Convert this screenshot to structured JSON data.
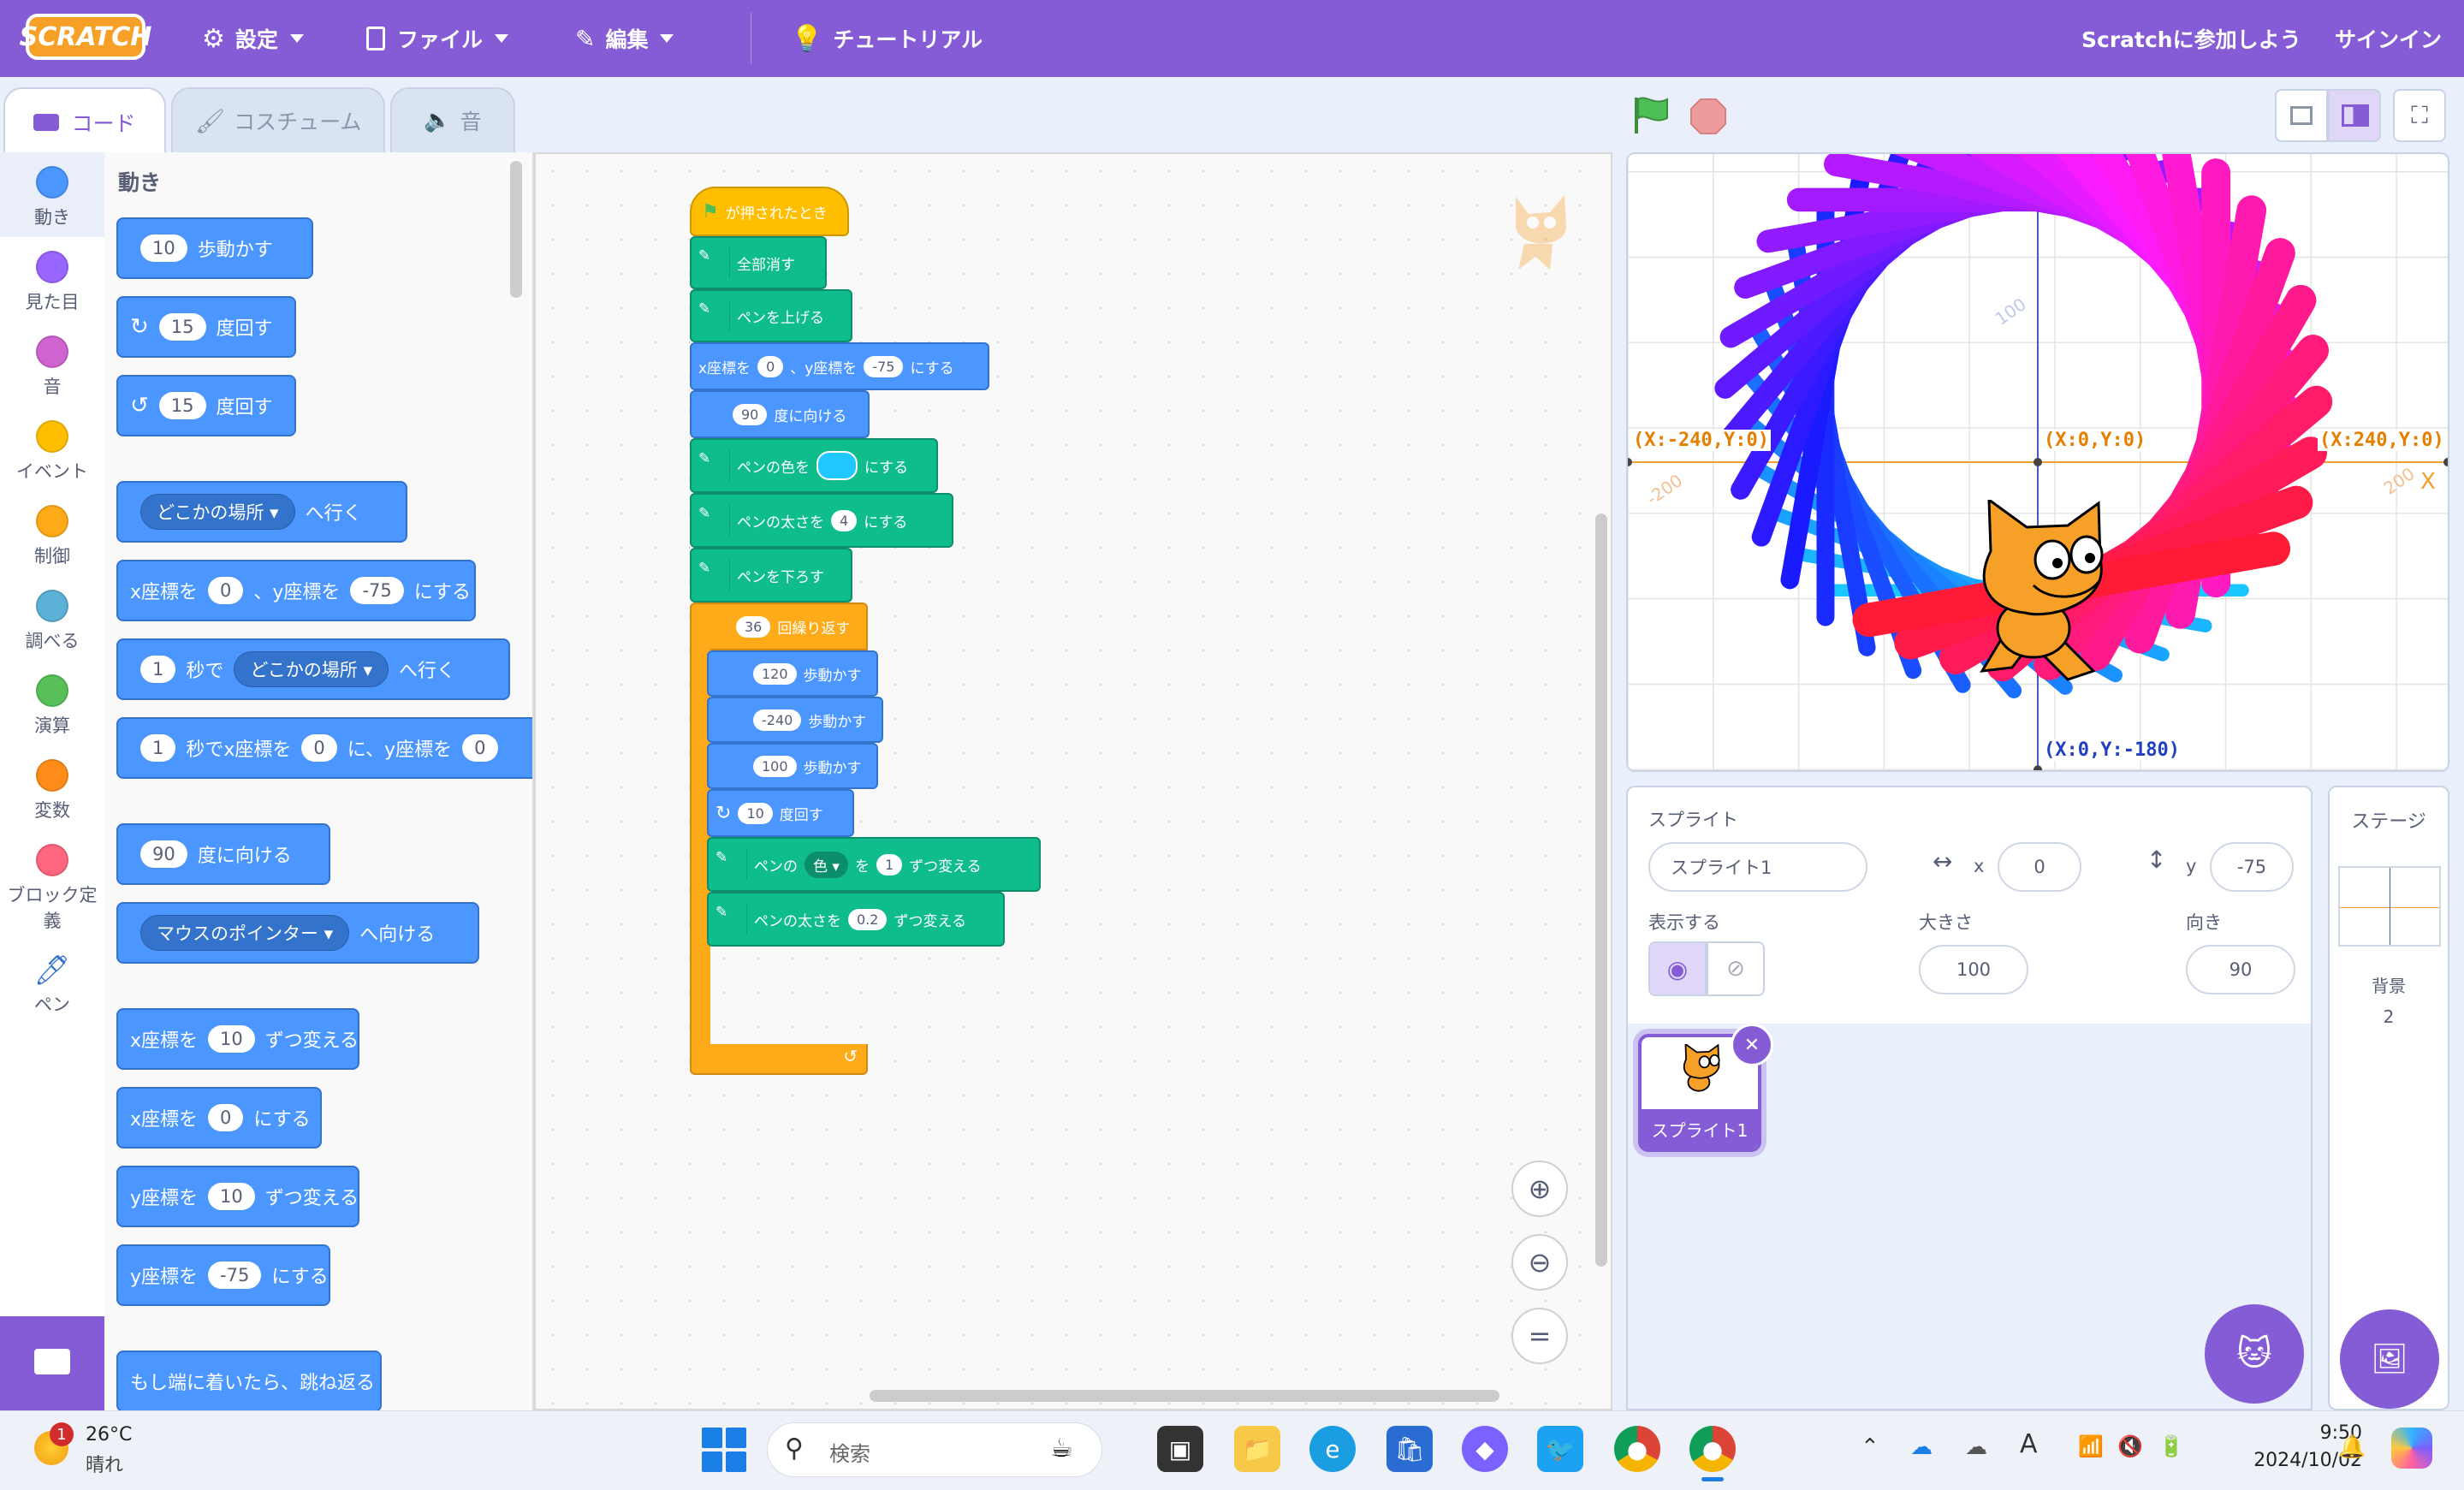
{
  "menu": {
    "logo": "SCRATCH",
    "settings": "設定",
    "file": "ファイル",
    "edit": "編集",
    "tutorials": "チュートリアル",
    "join": "Scratchに参加しよう",
    "signin": "サインイン"
  },
  "tabs": {
    "code": "コード",
    "costumes": "コスチューム",
    "sounds": "音"
  },
  "categories": [
    {
      "label": "動き",
      "color": "#4c97ff"
    },
    {
      "label": "見た目",
      "color": "#9966ff"
    },
    {
      "label": "音",
      "color": "#cf63cf"
    },
    {
      "label": "イベント",
      "color": "#ffbf00"
    },
    {
      "label": "制御",
      "color": "#ffab19"
    },
    {
      "label": "調べる",
      "color": "#5cb1d6"
    },
    {
      "label": "演算",
      "color": "#59c059"
    },
    {
      "label": "変数",
      "color": "#ff8c1a"
    },
    {
      "label": "ブロック定義",
      "color": "#ff6680"
    },
    {
      "label": "ペン",
      "color": "#0fbd8c"
    }
  ],
  "palette": {
    "heading": "動き",
    "move": {
      "value": "10",
      "suffix": "歩動かす"
    },
    "turn_right": {
      "value": "15",
      "suffix": "度回す"
    },
    "turn_left": {
      "value": "15",
      "suffix": "度回す"
    },
    "goto": {
      "drop": "どこかの場所",
      "suffix": "へ行く"
    },
    "setxy": {
      "p1": "x座標を",
      "x": "0",
      "p2": "、y座標を",
      "y": "-75",
      "p3": "にする"
    },
    "glide_to": {
      "secs": "1",
      "p1": "秒で",
      "drop": "どこかの場所",
      "p2": "へ行く"
    },
    "glide_xy": {
      "secs": "1",
      "p1": "秒でx座標を",
      "x": "0",
      "p2": "に、y座標を",
      "y": "0"
    },
    "point_dir": {
      "value": "90",
      "suffix": "度に向ける"
    },
    "point_towards": {
      "drop": "マウスのポインター",
      "suffix": "へ向ける"
    },
    "change_x": {
      "p1": "x座標を",
      "value": "10",
      "p2": "ずつ変える"
    },
    "set_x": {
      "p1": "x座標を",
      "value": "0",
      "p2": "にする"
    },
    "change_y": {
      "p1": "y座標を",
      "value": "10",
      "p2": "ずつ変える"
    },
    "set_y": {
      "p1": "y座標を",
      "value": "-75",
      "p2": "にする"
    },
    "bounce": "もし端に着いたら、跳ね返る"
  },
  "script": {
    "hat": "が押されたとき",
    "clear": "全部消す",
    "pen_up": "ペンを上げる",
    "goto_xy": {
      "p1": "x座標を",
      "x": "0",
      "p2": "、y座標を",
      "y": "-75",
      "p3": "にする"
    },
    "point": {
      "value": "90",
      "suffix": "度に向ける"
    },
    "set_color": {
      "p1": "ペンの色を",
      "p2": "にする",
      "color": "#21c7ff"
    },
    "set_size": {
      "p1": "ペンの太さを",
      "value": "4",
      "p2": "にする"
    },
    "pen_down": "ペンを下ろす",
    "repeat": {
      "value": "36",
      "suffix": "回繰り返す"
    },
    "move1": {
      "value": "120",
      "suffix": "歩動かす"
    },
    "move2": {
      "value": "-240",
      "suffix": "歩動かす"
    },
    "move3": {
      "value": "100",
      "suffix": "歩動かす"
    },
    "turn": {
      "value": "10",
      "suffix": "度回す"
    },
    "change_color": {
      "p1": "ペンの",
      "drop": "色",
      "p2": "を",
      "value": "1",
      "p3": "ずつ変える"
    },
    "change_size": {
      "p1": "ペンの太さを",
      "value": "0.2",
      "p2": "ずつ変える"
    }
  },
  "stage": {
    "left": "(X:-240,Y:0)",
    "center": "(X:0,Y:0)",
    "right": "(X:240,Y:0)",
    "bottom": "(X:0,Y:-180)",
    "axis_x": "X",
    "tick_100": "100",
    "tick_m200": "-200",
    "tick_200": "200"
  },
  "sprite_info": {
    "sprite_label": "スプライト",
    "name": "スプライト1",
    "x_label": "x",
    "x": "0",
    "y_label": "y",
    "y": "-75",
    "show_label": "表示する",
    "size_label": "大きさ",
    "size": "100",
    "dir_label": "向き",
    "direction": "90"
  },
  "sprite_list": {
    "thumb_name": "スプライト1"
  },
  "stage_panel": {
    "title": "ステージ",
    "backdrops_label": "背景",
    "backdrops_count": "2"
  },
  "taskbar": {
    "temp": "26°C",
    "weather": "晴れ",
    "badge": "1",
    "search_placeholder": "検索",
    "time": "9:50",
    "date": "2024/10/02"
  }
}
